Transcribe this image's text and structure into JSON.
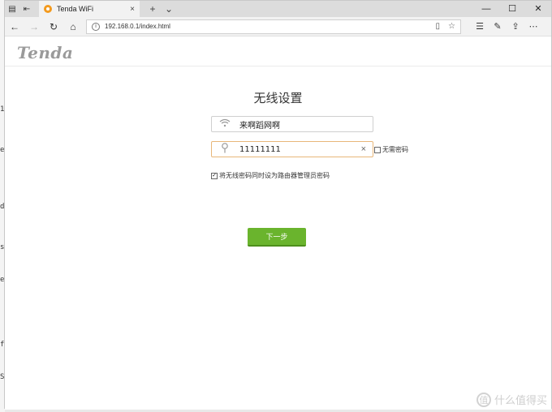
{
  "browser": {
    "tab": {
      "title": "Tenda WiFi",
      "close": "×"
    },
    "tab_actions": {
      "new_tab": "+",
      "tab_list": "⌄"
    },
    "window_controls": {
      "minimize": "—",
      "maximize": "☐",
      "close": "✕"
    },
    "address": "192.168.0.1/index.html"
  },
  "page": {
    "logo": "Tenda",
    "heading": "无线设置",
    "ssid": {
      "value": "来啊蹈网啊"
    },
    "password": {
      "value": "11111111",
      "clear": "×"
    },
    "no_password": {
      "label": "无需密码",
      "checked": false
    },
    "admin_same": {
      "label": "将无线密码同时设为路由器管理员密码",
      "checked": true,
      "mark": "✓"
    },
    "next_button": "下一步"
  },
  "watermark": {
    "mark": "值",
    "text": "什么值得买"
  },
  "colors": {
    "accent_green": "#6ab42d",
    "focus_border": "#e8b77a",
    "logo_gray": "#9a9a9a"
  }
}
